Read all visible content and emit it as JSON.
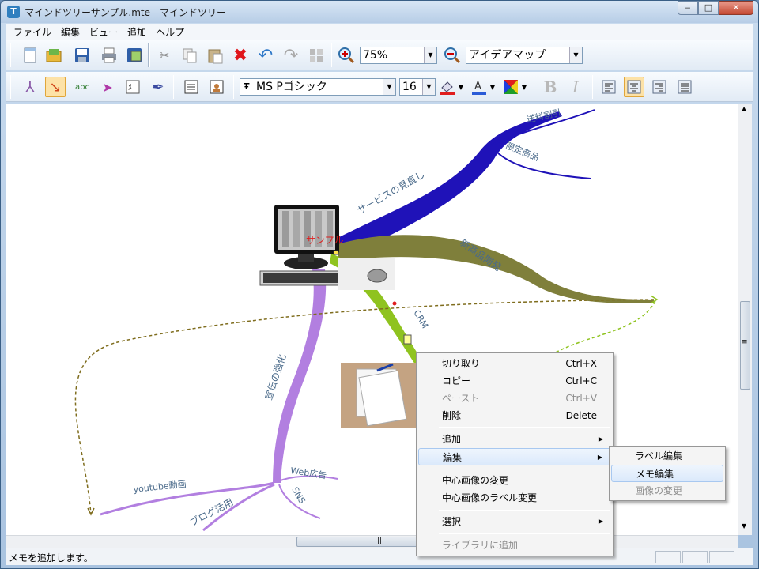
{
  "window": {
    "title": "マインドツリーサンプル.mte - マインドツリー",
    "icon_char": "T",
    "controls": {
      "minimize": "‒",
      "maximize": "□",
      "close": "✕"
    }
  },
  "menu": [
    "ファイル",
    "編集",
    "ビュー",
    "追加",
    "ヘルプ"
  ],
  "toolbar": {
    "zoom": "75%",
    "view_mode": "アイデアマップ",
    "font_name": "MS Pゴシック",
    "font_size": "16",
    "bold": "B",
    "italic": "I"
  },
  "map": {
    "center_label": "サンプル",
    "branches": [
      {
        "label": "サービスの見直し",
        "color": "#1f12b8",
        "children": [
          "送料割引",
          "限定商品"
        ]
      },
      {
        "label": "新商品開発",
        "color": "#7f7f3b",
        "children": []
      },
      {
        "label": "CRM",
        "color": "#8fc31f",
        "children": []
      },
      {
        "label": "宣伝の強化",
        "color": "#b27fe0",
        "children": [
          "youtube動画",
          "ブログ活用",
          "Web広告",
          "SNS"
        ]
      }
    ]
  },
  "context_menu": {
    "items": [
      {
        "label": "切り取り",
        "shortcut": "Ctrl+X",
        "enabled": true
      },
      {
        "label": "コピー",
        "shortcut": "Ctrl+C",
        "enabled": true
      },
      {
        "label": "ペースト",
        "shortcut": "Ctrl+V",
        "enabled": false
      },
      {
        "label": "削除",
        "shortcut": "Delete",
        "enabled": true
      },
      {
        "label": "追加",
        "submenu": true,
        "enabled": true
      },
      {
        "label": "編集",
        "submenu": true,
        "enabled": true,
        "highlighted": true
      },
      {
        "label": "中心画像の変更",
        "enabled": true
      },
      {
        "label": "中心画像のラベル変更",
        "enabled": true
      },
      {
        "label": "選択",
        "submenu": true,
        "enabled": true
      },
      {
        "label": "ライブラリに追加",
        "enabled": false
      }
    ],
    "submenu_arrow": "▶"
  },
  "edit_submenu": {
    "items": [
      {
        "label": "ラベル編集",
        "enabled": true
      },
      {
        "label": "メモ編集",
        "enabled": true,
        "highlighted": true
      },
      {
        "label": "画像の変更",
        "enabled": false
      }
    ]
  },
  "status": {
    "message": "メモを追加します。"
  },
  "scroll": {
    "up": "▲",
    "down": "▼",
    "grip": "≡",
    "hgrip": "|||"
  }
}
